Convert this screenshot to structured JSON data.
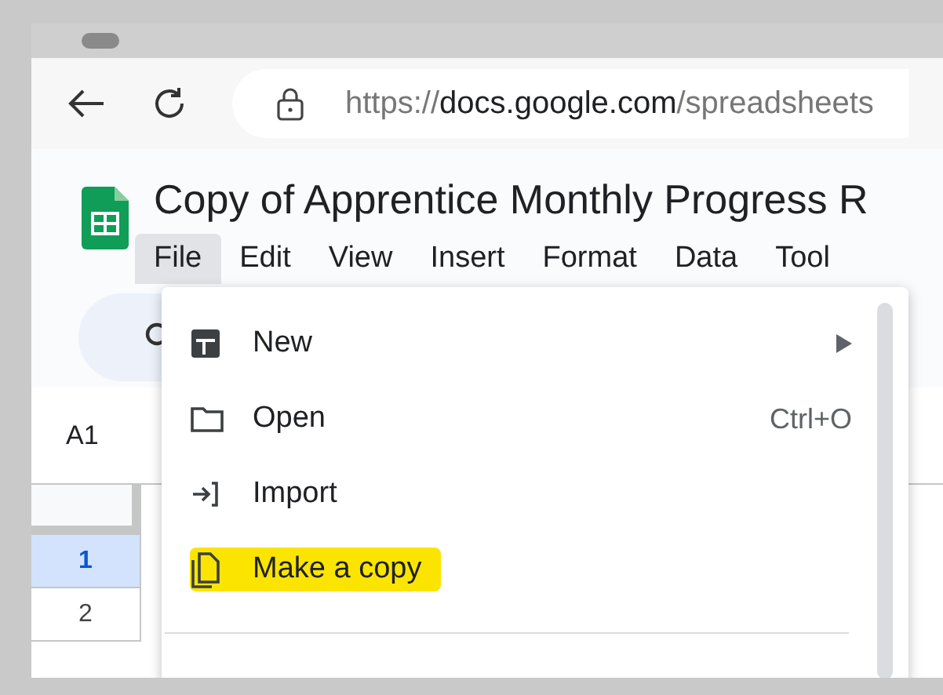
{
  "address_bar": {
    "scheme": "https://",
    "domain": "docs.google.com",
    "path": "/spreadsheets"
  },
  "document": {
    "title": "Copy of Apprentice Monthly Progress R"
  },
  "menu_bar": [
    {
      "label": "File",
      "selected": true
    },
    {
      "label": "Edit",
      "selected": false
    },
    {
      "label": "View",
      "selected": false
    },
    {
      "label": "Insert",
      "selected": false
    },
    {
      "label": "Format",
      "selected": false
    },
    {
      "label": "Data",
      "selected": false
    },
    {
      "label": "Tool",
      "selected": false
    }
  ],
  "name_box": "A1",
  "rows": [
    {
      "label": "1",
      "selected": true
    },
    {
      "label": "2",
      "selected": false
    }
  ],
  "file_menu": [
    {
      "kind": "new",
      "label": "New",
      "submenu": true,
      "highlighted": false
    },
    {
      "kind": "open",
      "label": "Open",
      "shortcut": "Ctrl+O",
      "submenu": false,
      "highlighted": false
    },
    {
      "kind": "import",
      "label": "Import",
      "submenu": false,
      "highlighted": false
    },
    {
      "kind": "copy",
      "label": "Make a copy",
      "submenu": false,
      "highlighted": true
    }
  ]
}
